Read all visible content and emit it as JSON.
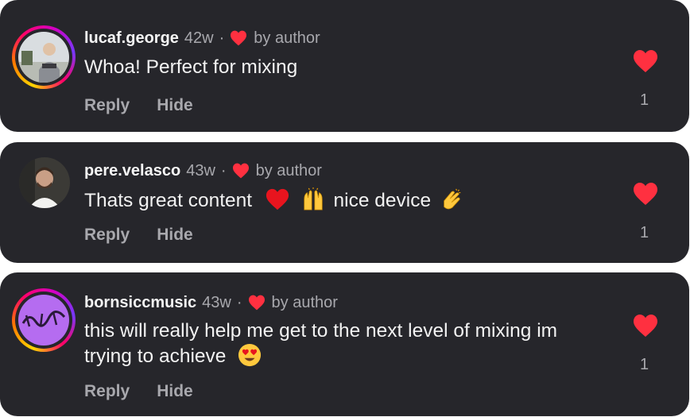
{
  "comments": [
    {
      "username": "lucaf.george",
      "time": "42w",
      "separator": "·",
      "author_badge": "by author",
      "text": "Whoa! Perfect for mixing",
      "reply_label": "Reply",
      "hide_label": "Hide",
      "like_count": "1"
    },
    {
      "username": "pere.velasco",
      "time": "43w",
      "separator": "·",
      "author_badge": "by author",
      "text_parts": [
        "Thats great content",
        "nice device"
      ],
      "emojis": [
        "red-heart",
        "raising-hands",
        "clapping-hands"
      ],
      "reply_label": "Reply",
      "hide_label": "Hide",
      "like_count": "1"
    },
    {
      "username": "bornsiccmusic",
      "time": "43w",
      "separator": "·",
      "author_badge": "by author",
      "text": "this will really help me get to the next level of mixing im trying to achieve",
      "emojis": [
        "heart-eyes"
      ],
      "reply_label": "Reply",
      "hide_label": "Hide",
      "like_count": "1"
    }
  ],
  "colors": {
    "card_bg": "#26262b",
    "text_primary": "#f5f5f5",
    "text_secondary": "#a8a8ad",
    "like_red": "#ff3040"
  }
}
